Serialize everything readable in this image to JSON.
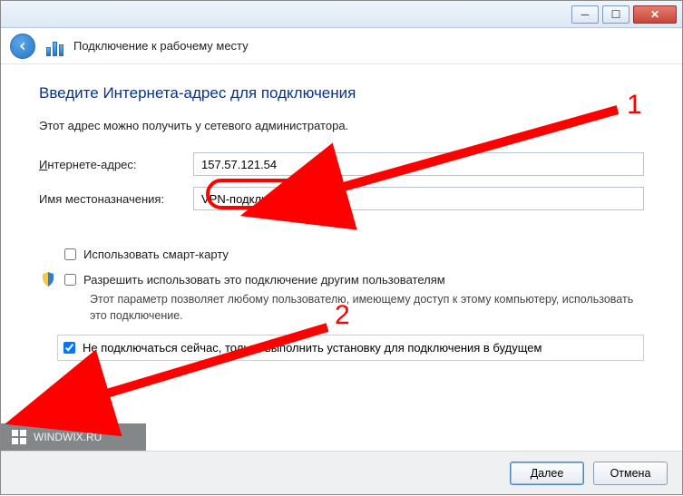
{
  "window": {
    "title": "Подключение к рабочему месту",
    "min_glyph": "─",
    "max_glyph": "☐",
    "close_glyph": "✕"
  },
  "content": {
    "heading": "Введите Интернета-адрес для подключения",
    "subtext": "Этот адрес можно получить у сетевого администратора.",
    "address_label_prefix": "И",
    "address_label_rest": "нтернете-адрес:",
    "address_value": "157.57.121.54",
    "dest_label": "Имя местоназначения:",
    "dest_value": "VPN-подключение",
    "opt_smartcard": "Использовать смарт-карту",
    "opt_allow": "Разрешить использовать это подключение другим пользователям",
    "opt_allow_desc": "Этот параметр позволяет любому пользователю, имеющему доступ к этому компьютеру, использовать это подключение.",
    "opt_defer": "Не подключаться сейчас, только выполнить установку для подключения в будущем"
  },
  "footer": {
    "next": "Далее",
    "cancel": "Отмена"
  },
  "annotations": {
    "n1": "1",
    "n2": "2"
  },
  "watermark": {
    "text": "WINDWIX.RU"
  }
}
